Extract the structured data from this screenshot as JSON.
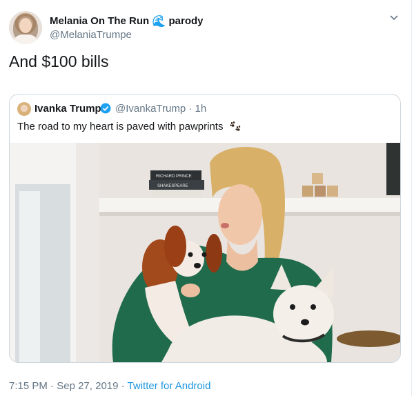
{
  "tweet": {
    "author_name": "Melania On The Run",
    "author_badge_icon": "wave-icon",
    "author_badge_text": "parody",
    "author_handle": "@MelaniaTrumpe",
    "text": "And $100 bills",
    "time": "7:15 PM",
    "date": "Sep 27, 2019",
    "separator": "·",
    "source": "Twitter for Android"
  },
  "quoted": {
    "author_name": "Ivanka Trump",
    "verified_icon": "verified-badge-icon",
    "author_handle": "@IvankaTrump",
    "age": "1h",
    "text": "The road to my heart is paved with pawprints",
    "emoji_icon": "paw-prints-icon",
    "photo": "woman-holding-two-dogs",
    "book_title_line1": "RICHARD PRINCE",
    "book_title_line2": "SHAKESPEARE"
  },
  "colors": {
    "link": "#1b95e0",
    "secondary_text": "#657786",
    "border": "#ccd6dd",
    "verified": "#1da1f2"
  }
}
